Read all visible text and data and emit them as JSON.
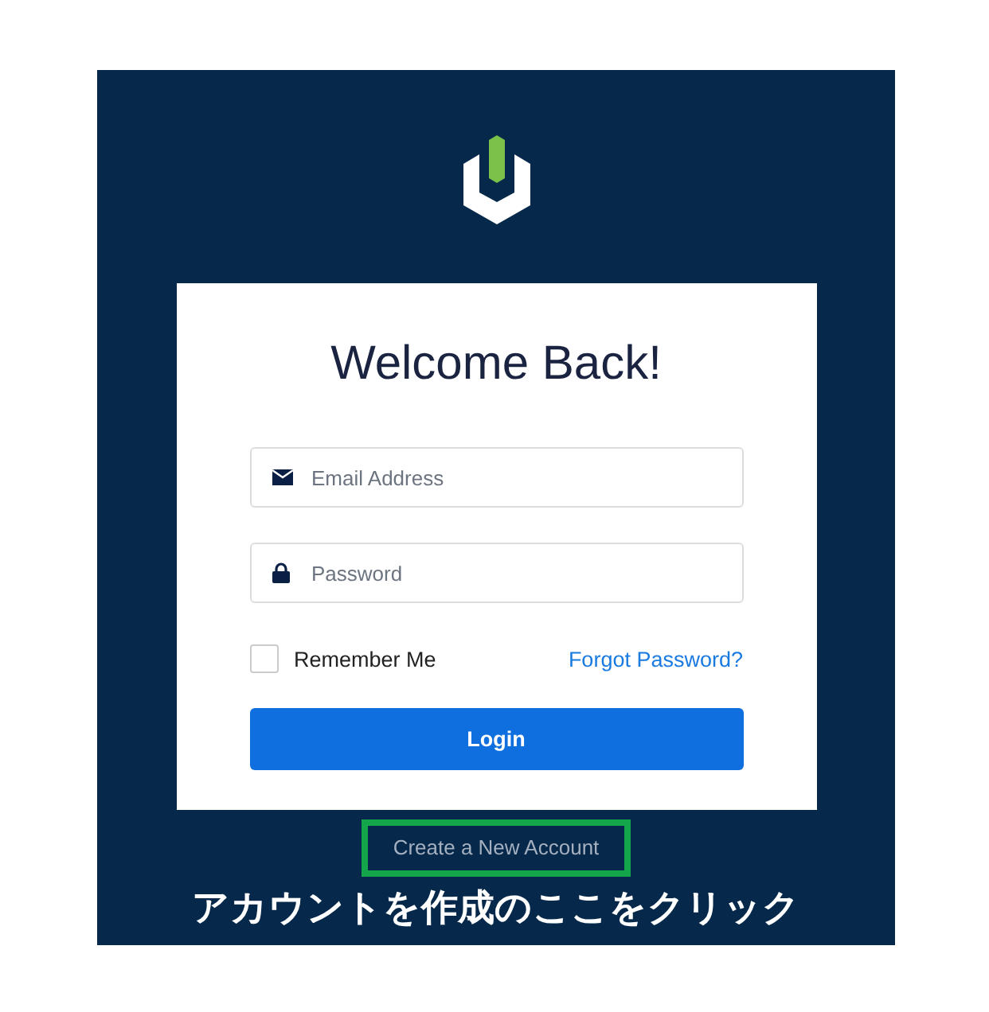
{
  "card": {
    "title": "Welcome Back!",
    "fields": [
      {
        "kind": "email",
        "placeholder": "Email Address"
      },
      {
        "kind": "password",
        "placeholder": "Password"
      }
    ],
    "remember": {
      "label": "Remember Me",
      "checked": false
    },
    "forgot_link": "Forgot Password?",
    "login_button": "Login"
  },
  "create_account_link": {
    "label": "Create a New Account",
    "highlighted": true
  },
  "annotation": "アカウントを作成のここをクリック"
}
